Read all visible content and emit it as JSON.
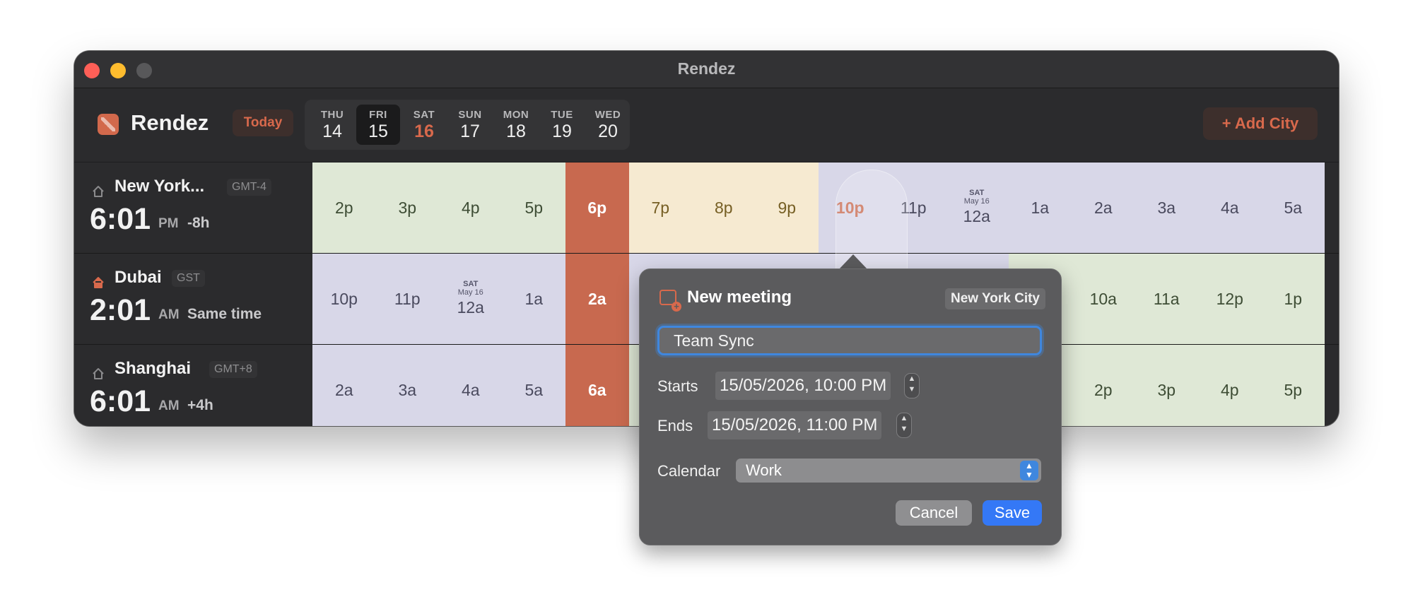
{
  "window": {
    "title": "Rendez"
  },
  "toolbar": {
    "app_name": "Rendez",
    "today_label": "Today",
    "add_city_label": "+ Add City"
  },
  "days": [
    {
      "dow": "THU",
      "num": "14"
    },
    {
      "dow": "FRI",
      "num": "15",
      "selected": true
    },
    {
      "dow": "SAT",
      "num": "16",
      "weekend_highlight": true
    },
    {
      "dow": "SUN",
      "num": "17"
    },
    {
      "dow": "MON",
      "num": "18"
    },
    {
      "dow": "TUE",
      "num": "19"
    },
    {
      "dow": "WED",
      "num": "20"
    }
  ],
  "cities": [
    {
      "name": "New York...",
      "tz": "GMT-4",
      "time": "6:01",
      "ampm": "PM",
      "diff": "-8h",
      "home": false
    },
    {
      "name": "Dubai",
      "tz": "GST",
      "time": "2:01",
      "ampm": "AM",
      "diff": "Same time",
      "home": true
    },
    {
      "name": "Shanghai",
      "tz": "GMT+8",
      "time": "6:01",
      "ampm": "AM",
      "diff": "+4h",
      "home": false
    }
  ],
  "timeline": {
    "rows": [
      [
        {
          "l": "2p",
          "k": "day"
        },
        {
          "l": "3p",
          "k": "day"
        },
        {
          "l": "4p",
          "k": "day"
        },
        {
          "l": "5p",
          "k": "day"
        },
        {
          "l": "6p",
          "k": "now"
        },
        {
          "l": "7p",
          "k": "eve"
        },
        {
          "l": "8p",
          "k": "eve"
        },
        {
          "l": "9p",
          "k": "eve"
        },
        {
          "l": "10p",
          "k": "night",
          "sel": true
        },
        {
          "l": "11p",
          "k": "night"
        },
        {
          "l": "12a",
          "k": "night",
          "top": "SAT",
          "sub": "May 16"
        },
        {
          "l": "1a",
          "k": "night"
        },
        {
          "l": "2a",
          "k": "night"
        },
        {
          "l": "3a",
          "k": "night"
        },
        {
          "l": "4a",
          "k": "night"
        },
        {
          "l": "5a",
          "k": "night"
        }
      ],
      [
        {
          "l": "10p",
          "k": "night"
        },
        {
          "l": "11p",
          "k": "night"
        },
        {
          "l": "12a",
          "k": "night",
          "top": "SAT",
          "sub": "May 16"
        },
        {
          "l": "1a",
          "k": "night"
        },
        {
          "l": "2a",
          "k": "now"
        },
        {
          "l": "",
          "k": "night"
        },
        {
          "l": "",
          "k": "night"
        },
        {
          "l": "",
          "k": "night"
        },
        {
          "l": "",
          "k": "night"
        },
        {
          "l": "",
          "k": "night"
        },
        {
          "l": "",
          "k": "night"
        },
        {
          "l": "",
          "k": "day"
        },
        {
          "l": "10a",
          "k": "day"
        },
        {
          "l": "11a",
          "k": "day"
        },
        {
          "l": "12p",
          "k": "day"
        },
        {
          "l": "1p",
          "k": "day"
        }
      ],
      [
        {
          "l": "2a",
          "k": "night"
        },
        {
          "l": "3a",
          "k": "night"
        },
        {
          "l": "4a",
          "k": "night"
        },
        {
          "l": "5a",
          "k": "night"
        },
        {
          "l": "6a",
          "k": "now"
        },
        {
          "l": "",
          "k": "day"
        },
        {
          "l": "",
          "k": "day"
        },
        {
          "l": "",
          "k": "day"
        },
        {
          "l": "",
          "k": "day"
        },
        {
          "l": "",
          "k": "day"
        },
        {
          "l": "",
          "k": "day"
        },
        {
          "l": "",
          "k": "day"
        },
        {
          "l": "2p",
          "k": "day"
        },
        {
          "l": "3p",
          "k": "day"
        },
        {
          "l": "4p",
          "k": "day"
        },
        {
          "l": "5p",
          "k": "day"
        }
      ]
    ]
  },
  "popover": {
    "title": "New meeting",
    "city_badge": "New York City",
    "name_value": "Team Sync",
    "starts_label": "Starts",
    "starts_value": "15/05/2026, 10:00 PM",
    "ends_label": "Ends",
    "ends_value": "15/05/2026, 11:00 PM",
    "calendar_label": "Calendar",
    "calendar_value": "Work",
    "cancel_label": "Cancel",
    "save_label": "Save"
  },
  "colors": {
    "accent": "#d8694c",
    "now_column": "#c8694f",
    "day_band": "#dfe8d6",
    "evening_band": "#f6ead1",
    "night_band": "#d8d7e8",
    "save_button": "#3478f6"
  }
}
